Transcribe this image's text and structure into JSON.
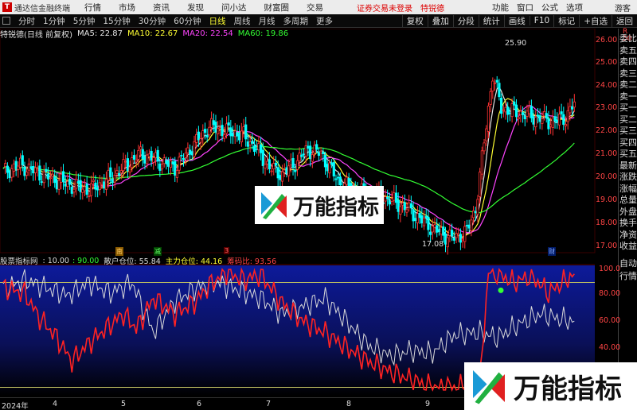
{
  "titlebar": {
    "app_name": "通达信金融终端",
    "menus": [
      "行情",
      "市场",
      "资讯",
      "发现",
      "问小达",
      "财富圈",
      "交易"
    ],
    "login_status": "证券交易未登录",
    "stock_button": "特锐德",
    "right_buttons": [
      "功能",
      "窗口",
      "公式",
      "选项"
    ],
    "guest": "游客"
  },
  "periodbar": {
    "periods": [
      "分时",
      "1分钟",
      "5分钟",
      "15分钟",
      "30分钟",
      "60分钟",
      "日线",
      "周线",
      "月线",
      "多周期",
      "更多"
    ],
    "active": "日线",
    "right_buttons": [
      "复权",
      "叠加",
      "分段",
      "统计",
      "画线",
      "F10",
      "标记",
      "+自选",
      "返回"
    ]
  },
  "main_info": {
    "stock": "特锐德(日线 前复权)",
    "ma5": "MA5: 22.87",
    "ma10": "MA10: 22.67",
    "ma20": "MA20: 22.54",
    "ma60": "MA60: 19.86"
  },
  "price_axis": [
    "26.00",
    "25.00",
    "24.00",
    "23.00",
    "22.00",
    "21.00",
    "20.00",
    "19.00",
    "18.00",
    "17.00"
  ],
  "annotations": {
    "high": "25.90",
    "low": "17.08"
  },
  "r_top": "R\n50",
  "vertical_tabs": [
    "委比",
    "卖五",
    "卖四",
    "卖三",
    "卖二",
    "卖一",
    "买一",
    "买二",
    "买三",
    "买四",
    "买五",
    "最新",
    "涨跌",
    "涨幅",
    "总量",
    "外盘",
    "换手",
    "净资",
    "收益"
  ],
  "lower_tabs": [
    "自动",
    "行情"
  ],
  "indicator": {
    "name": "股票指标网",
    "value1": ": 10.00",
    "value2": ": 90.00",
    "retail": "散户仓位: 55.84",
    "main": "主力仓位: 44.16",
    "ratio": "筹码比: 93.56"
  },
  "indicator_axis": [
    "100.0",
    "80.00",
    "60.00",
    "40.00",
    "20.00"
  ],
  "date_axis": [
    "2024年",
    "4",
    "5",
    "6",
    "7",
    "8",
    "9",
    "10",
    "11",
    "12"
  ],
  "markers": [
    "南",
    "减",
    "3",
    "财"
  ],
  "watermark": "万能指标",
  "colors": {
    "up": "#ff3333",
    "down": "#00ffff",
    "ma5": "#e6e6e6",
    "ma10": "#ffff33",
    "ma20": "#ff44ff",
    "ma60": "#33ff33",
    "indicator_bg": "#0b1170",
    "retail_line": "#d9d9d9",
    "main_line": "#ff2222",
    "level_line": "#bdbd60"
  }
}
